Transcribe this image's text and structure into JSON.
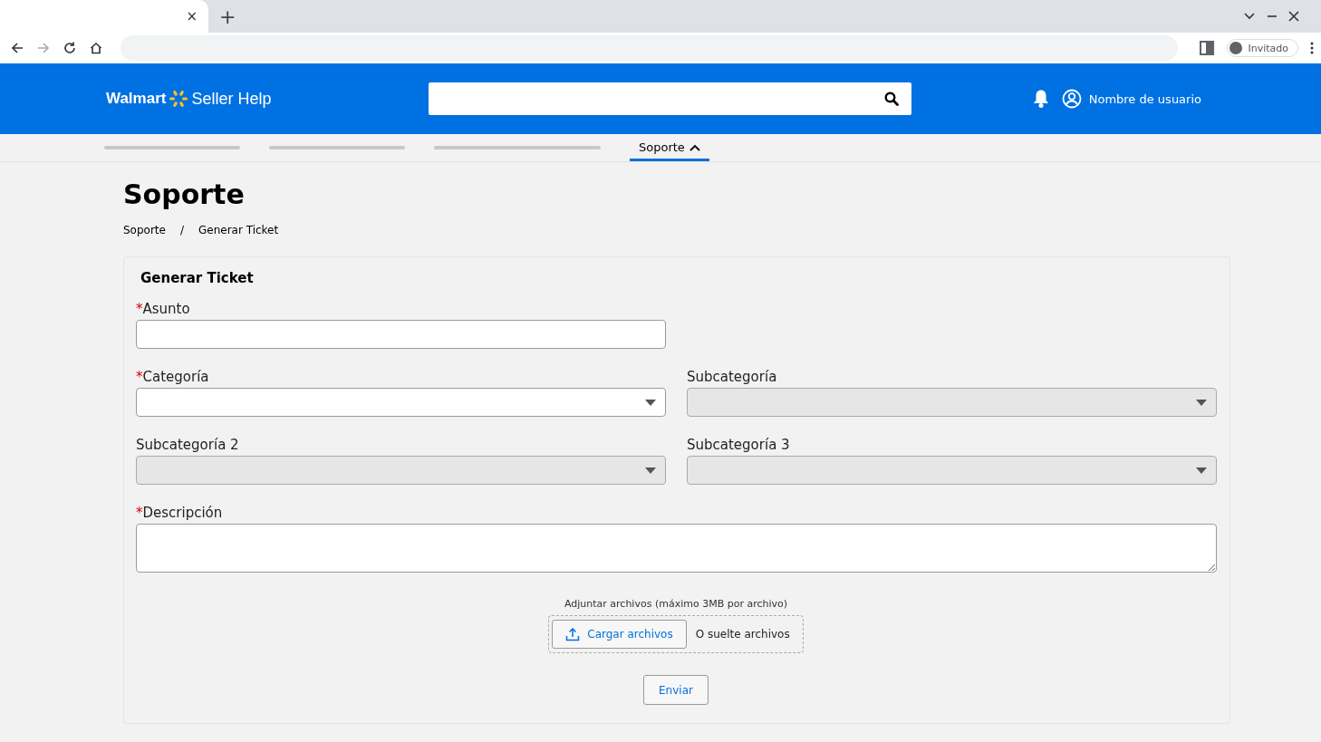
{
  "browser": {
    "tab_close": "×",
    "new_tab": "+",
    "profile": "Invitado"
  },
  "header": {
    "brand": "Walmart",
    "product": "Seller Help",
    "user": "Nombre de usuario"
  },
  "nav": [
    {
      "kind": "placeholder"
    },
    {
      "kind": "placeholder"
    },
    {
      "kind": "placeholder"
    },
    {
      "kind": "link",
      "label": "Soporte",
      "selected": true,
      "expanded": true
    }
  ],
  "page": {
    "title": "Soporte",
    "breadcrumb": [
      "Soporte",
      "Generar Ticket"
    ],
    "breadcrumb_separator": "/"
  },
  "form": {
    "title": "Generar Ticket",
    "fields": [
      {
        "kind": "text",
        "label": "Asunto",
        "marker": "*",
        "disabled": false
      },
      {
        "kind": "spacer"
      },
      {
        "kind": "select",
        "label": "Categoría",
        "marker": "*",
        "disabled": false
      },
      {
        "kind": "select",
        "label": "Subcategoría",
        "disabled": true
      },
      {
        "kind": "select",
        "label": "Subcategoría 2",
        "disabled": true
      },
      {
        "kind": "select",
        "label": "Subcategoría 3",
        "disabled": true
      },
      {
        "kind": "textarea",
        "label": "Descripción",
        "marker": "*",
        "disabled": false
      }
    ],
    "attach": {
      "label": "Adjuntar archivos (máximo 3MB por archivo)",
      "button": "Cargar archivos",
      "drop_text": "O suelte archivos"
    },
    "submit": "Enviar"
  }
}
